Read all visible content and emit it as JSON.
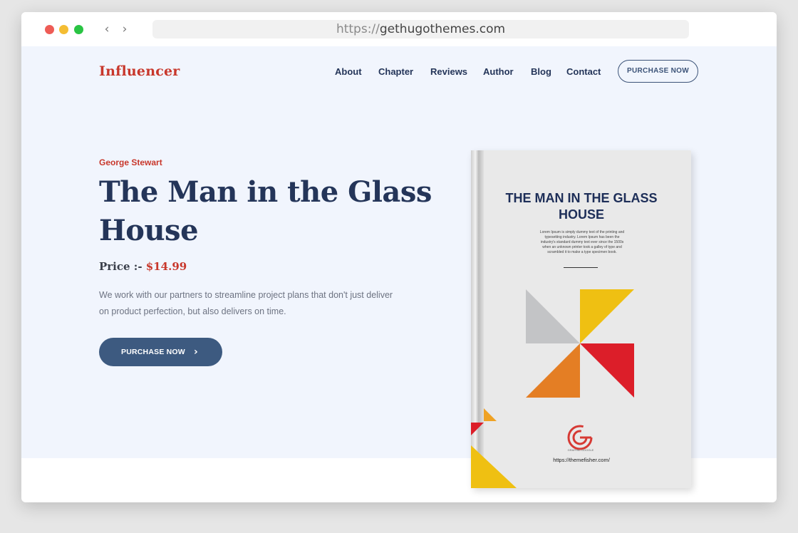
{
  "browser": {
    "url_protocol": "https://",
    "url_host": "gethugothemes.com"
  },
  "site": {
    "logo": "Influencer",
    "nav": [
      "About",
      "Chapter",
      "Reviews",
      "Author",
      "Blog",
      "Contact"
    ],
    "nav_button": "PURCHASE NOW"
  },
  "hero": {
    "author": "George Stewart",
    "title": "The Man in the Glass House",
    "price_label": "Price :-",
    "price_value": "$14.99",
    "description": "We work with our partners to streamline project plans that don't just deliver on product perfection, but also delivers on time.",
    "cta": "PURCHASE NOW"
  },
  "book": {
    "cover_title": "THE MAN IN THE GLASS HOUSE",
    "blurb": "Lorem Ipsum is simply dummy text of the printing and typesetting industry. Lorem Ipsum has been the industry's standard dummy text ever since the 1500s when an unknown printer took a galley of type and scrambled it to make a type specimen book.",
    "logo_caption": "GRAPHIC GOOGLE",
    "url": "https://themefisher.com/"
  },
  "colors": {
    "brand_red": "#c8372b",
    "navy": "#243559",
    "cta_blue": "#3d5a80",
    "hero_bg": "#f1f5fd"
  }
}
